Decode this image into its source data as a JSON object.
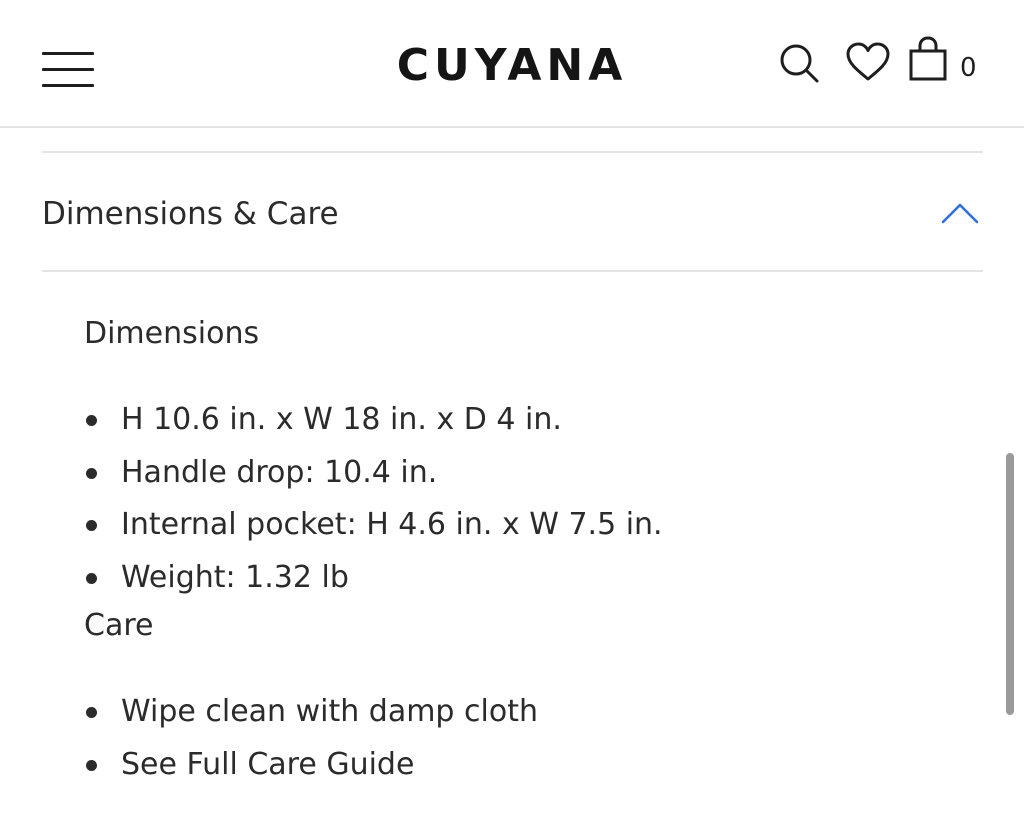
{
  "header": {
    "brand": "CUYANA",
    "cart_count": "0",
    "icons": [
      "menu-icon",
      "search-icon",
      "heart-icon",
      "shopping-bag-icon"
    ]
  },
  "accordion": {
    "title": "Dimensions & Care",
    "state": "expanded",
    "accent_color": "#2f6fd6"
  },
  "dimensions": {
    "heading": "Dimensions",
    "items": [
      "H 10.6 in. x W 18 in. x D 4 in.",
      "Handle drop: 10.4 in.",
      "Internal pocket: H 4.6 in. x W 7.5 in.",
      "Weight: 1.32 lb"
    ]
  },
  "care": {
    "heading": "Care",
    "items": [
      "Wipe clean with damp cloth",
      "See Full Care Guide"
    ]
  }
}
